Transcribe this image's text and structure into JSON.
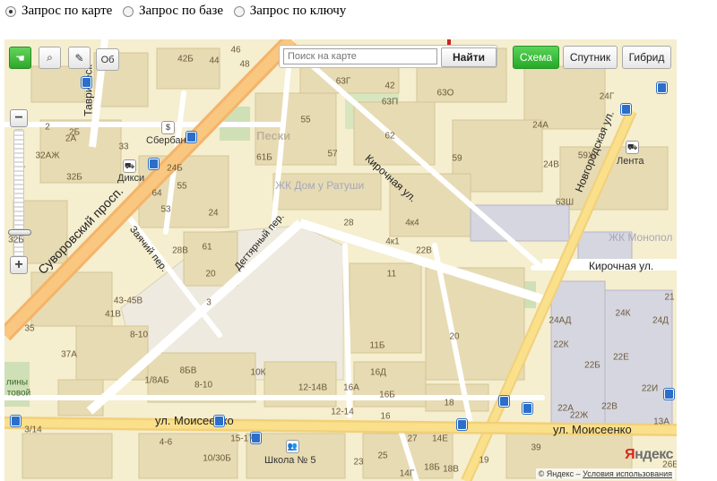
{
  "query_options": [
    {
      "label": "Запрос по карте",
      "selected": true
    },
    {
      "label": "Запрос по базе",
      "selected": false
    },
    {
      "label": "Запрос по ключу",
      "selected": false
    }
  ],
  "map": {
    "toolbar": {
      "truncated_button": "Об",
      "search_placeholder": "Поиск на карте",
      "search_button": "Найти",
      "map_types": [
        "Схема",
        "Спутник",
        "Гибрид"
      ],
      "active_type": "Схема"
    },
    "zoom": {
      "plus": "+",
      "minus": "−",
      "level_label": "32Б"
    },
    "streets": {
      "suvorovsky": "Суворовский просп.",
      "tavricheskaya": "Таврическ",
      "kirochnaya_diag": "Кирочная ул.",
      "kirochnaya_h": "Кирочная ул.",
      "novgorodskaya": "Новгородская ул.",
      "degtyarny": "Дегтярный пер.",
      "zachny": "Заячий пер.",
      "moiseenko_left": "ул. Моисеенко",
      "moiseenko_right": "ул. Моисеенко"
    },
    "district": "Пески",
    "zk_labels": [
      "ЖК Дом у Ратуши",
      "ЖК Монопол"
    ],
    "pois": {
      "sberbank": "Сбербанк",
      "diksi": "Дикси",
      "lenta": "Лента",
      "school": "Школа № 5"
    },
    "partial_text": [
      "лины",
      "товой"
    ],
    "house_numbers": [
      "46",
      "42Б",
      "44",
      "48",
      "63Г",
      "42",
      "63П",
      "63О",
      "24Г",
      "2",
      "2Б",
      "55",
      "2А",
      "33",
      "32АЖ",
      "61Б",
      "62",
      "57",
      "24А",
      "32Б",
      "61",
      "24Б",
      "24В",
      "59Ж",
      "55",
      "53",
      "64",
      "59",
      "4к4",
      "24",
      "28",
      "63Ш",
      "4к1",
      "22В",
      "28В",
      "61",
      "20",
      "3",
      "11",
      "37А",
      "43-45В",
      "41В",
      "35",
      "8-10",
      "11Б",
      "20",
      "8БВ",
      "10К",
      "16Д",
      "3/14",
      "1/8АБ",
      "8-10",
      "12-14В",
      "16А",
      "16Б",
      "18",
      "12-14",
      "16",
      "4-6",
      "15-17",
      "27",
      "14Е",
      "39",
      "10/30Б",
      "25",
      "23",
      "14Г",
      "18Б",
      "18В",
      "19",
      "22Ж",
      "22А",
      "22В",
      "22Е",
      "24К",
      "24Д",
      "24АД",
      "22К",
      "22Б",
      "22И",
      "21",
      "13А",
      "26Б",
      "39Б"
    ],
    "copyright": {
      "text": "© Яндекс –",
      "link": "Условия использования"
    },
    "logo": {
      "first": "Я",
      "rest": "ндекс"
    }
  }
}
